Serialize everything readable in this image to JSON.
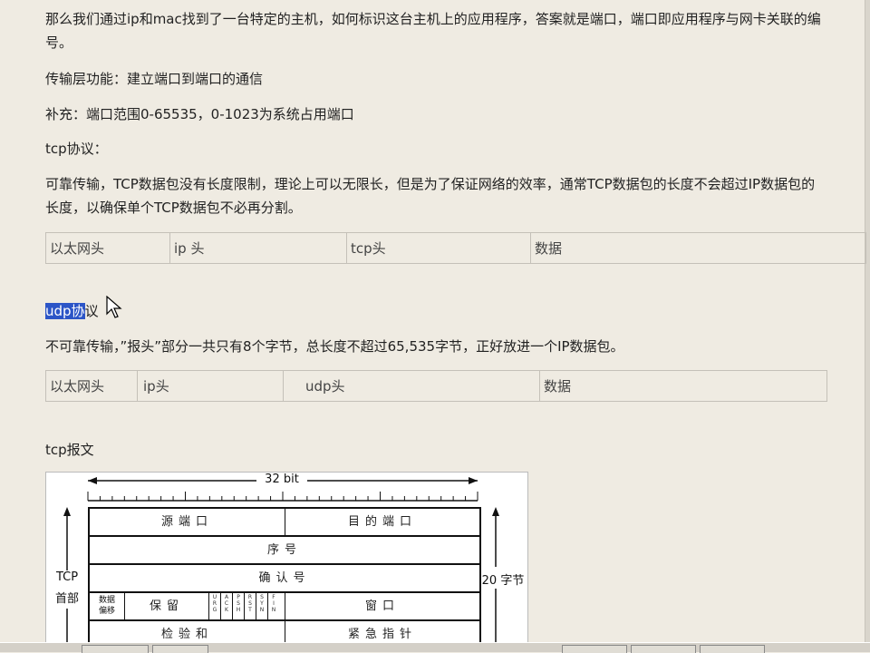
{
  "paragraphs": {
    "p1": "那么我们通过ip和mac找到了一台特定的主机，如何标识这台主机上的应用程序，答案就是端口，端口即应用程序与网卡关联的编号。",
    "p2": "传输层功能：建立端口到端口的通信",
    "p3": "补充：端口范围0-65535，0-1023为系统占用端口",
    "p4": "tcp协议：",
    "p5": "可靠传输，TCP数据包没有长度限制，理论上可以无限长，但是为了保证网络的效率，通常TCP数据包的长度不会超过IP数据包的长度，以确保单个TCP数据包不必再分割。"
  },
  "tcp_table": [
    "以太网头",
    "ip 头",
    "tcp头",
    "数据"
  ],
  "udp_heading": {
    "selected": "udp协",
    "rest": "议"
  },
  "udp_desc": "不可靠传输，”报头”部分一共只有8个字节，总长度不超过65,535字节，正好放进一个IP数据包。",
  "udp_table": [
    "以太网头",
    "ip头",
    "udp头",
    "数据"
  ],
  "tcp_packet_label": "tcp报文",
  "figure": {
    "width_label": "32 bit",
    "left_label_1": "TCP",
    "left_label_2": "首部",
    "right_label": "20 字节",
    "src_port": "源端口",
    "dst_port": "目的端口",
    "seq": "序号",
    "ack": "确认号",
    "offset_1": "数据",
    "offset_2": "偏移",
    "reserved": "保留",
    "flags": [
      "URG",
      "ACK",
      "PSH",
      "RST",
      "SYN",
      "FIN"
    ],
    "window": "窗口",
    "checksum": "检验和",
    "urgent": "紧急指针"
  }
}
